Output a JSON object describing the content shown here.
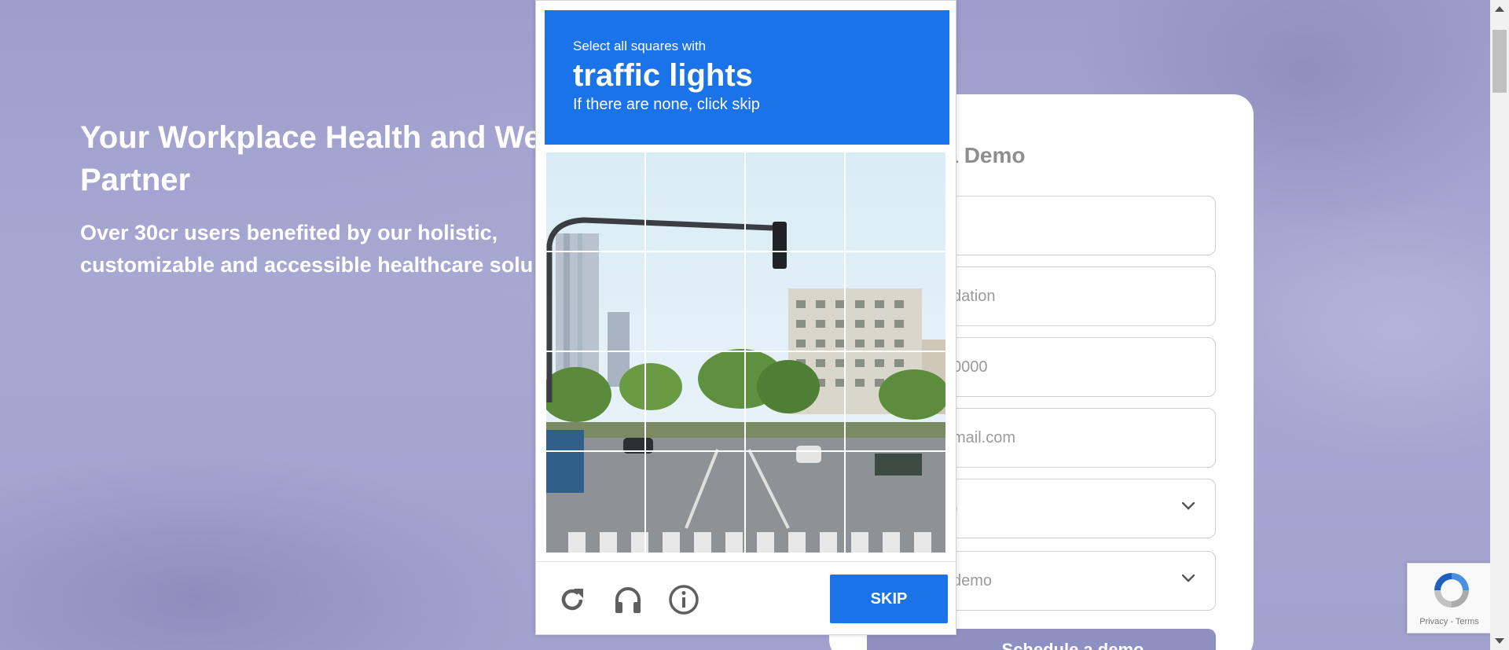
{
  "hero": {
    "title_line1": "Your Workplace Health and We",
    "title_line2": "Partner",
    "subtitle_line1": "Over 30cr users benefited by our holistic,",
    "subtitle_line2": "customizable and accessible healthcare solu"
  },
  "form": {
    "title": "e a Demo",
    "fields": [
      {
        "value": ""
      },
      {
        "value": "dation"
      },
      {
        "value": "0000"
      },
      {
        "value": "mail.com"
      },
      {
        "value": ")"
      },
      {
        "value": " demo"
      }
    ],
    "submit_label": "Schedule a demo"
  },
  "captcha": {
    "instruction": "Select all squares with",
    "target": "traffic lights",
    "hint": "If there are none, click skip",
    "skip_label": "SKIP",
    "icons": [
      "reload-icon",
      "audio-icon",
      "info-icon"
    ]
  },
  "recaptcha_badge": {
    "text": "Privacy - Terms"
  },
  "colors": {
    "captcha_blue": "#1a73e8",
    "background": "#a6a6cf",
    "button_purple": "#8f90c2"
  }
}
